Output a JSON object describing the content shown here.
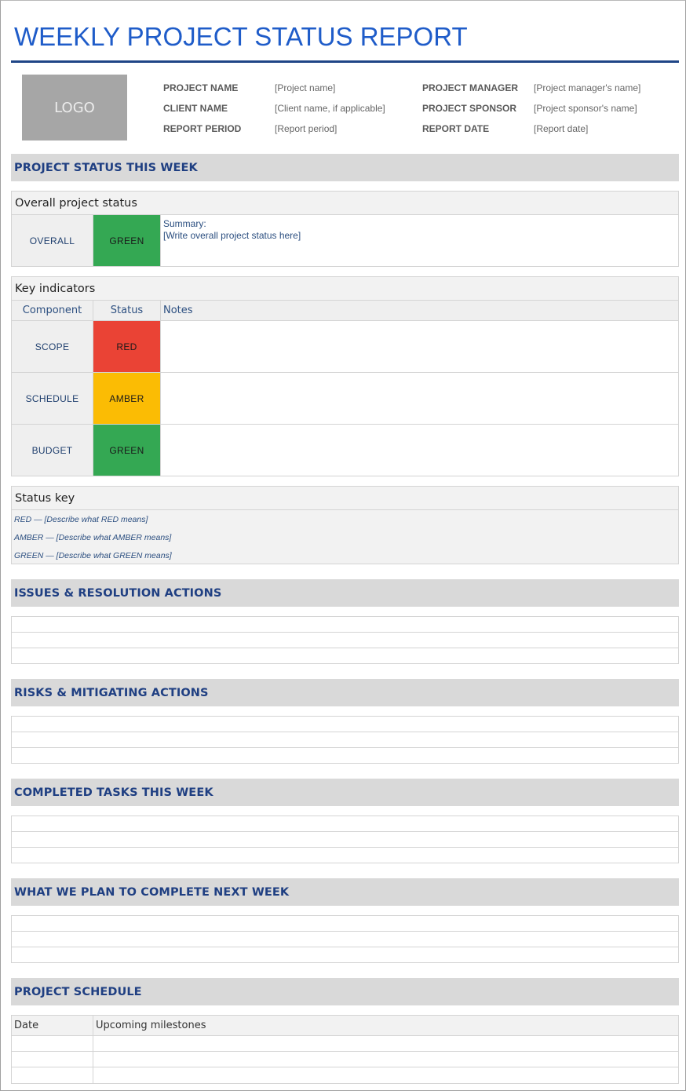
{
  "document": {
    "title": "WEEKLY PROJECT STATUS REPORT",
    "logo_label": "LOGO"
  },
  "meta": {
    "left": [
      {
        "label": "PROJECT NAME",
        "value": "[Project name]"
      },
      {
        "label": "CLIENT NAME",
        "value": "[Client name, if applicable]"
      },
      {
        "label": "REPORT PERIOD",
        "value": "[Report period]"
      }
    ],
    "right": [
      {
        "label": "PROJECT MANAGER",
        "value": "[Project manager's name]"
      },
      {
        "label": "PROJECT SPONSOR",
        "value": "[Project sponsor's name]"
      },
      {
        "label": "REPORT DATE",
        "value": "[Report date]"
      }
    ]
  },
  "status_section": {
    "header": "PROJECT STATUS THIS WEEK",
    "overall": {
      "title": "Overall project status",
      "component": "OVERALL",
      "status": "GREEN",
      "status_color": "#34a853",
      "summary_label": "Summary:",
      "summary_text": "[Write overall project status here]"
    },
    "key_indicators": {
      "title": "Key indicators",
      "columns": [
        "Component",
        "Status",
        "Notes"
      ],
      "rows": [
        {
          "component": "SCOPE",
          "status": "RED",
          "color": "#ea4335",
          "notes": ""
        },
        {
          "component": "SCHEDULE",
          "status": "AMBER",
          "color": "#fbbc04",
          "notes": ""
        },
        {
          "component": "BUDGET",
          "status": "GREEN",
          "color": "#34a853",
          "notes": ""
        }
      ]
    },
    "status_key": {
      "title": "Status key",
      "items": [
        "RED — [Describe what RED means]",
        "AMBER — [Describe what AMBER means]",
        "GREEN — [Describe what GREEN means]"
      ]
    }
  },
  "sections": {
    "issues": {
      "header": "ISSUES & RESOLUTION ACTIONS",
      "rows": [
        "",
        "",
        ""
      ]
    },
    "risks": {
      "header": "RISKS & MITIGATING ACTIONS",
      "rows": [
        "",
        "",
        ""
      ]
    },
    "completed": {
      "header": "COMPLETED TASKS THIS WEEK",
      "rows": [
        "",
        "",
        ""
      ]
    },
    "planned": {
      "header": "WHAT WE PLAN TO COMPLETE NEXT WEEK",
      "rows": [
        "",
        "",
        ""
      ]
    }
  },
  "schedule": {
    "header": "PROJECT SCHEDULE",
    "columns": [
      "Date",
      "Upcoming milestones"
    ],
    "rows": [
      {
        "date": "",
        "milestone": ""
      },
      {
        "date": "",
        "milestone": ""
      },
      {
        "date": "",
        "milestone": ""
      }
    ]
  },
  "colors": {
    "title_blue": "#1f5cc9",
    "rule_navy": "#1f4586",
    "section_header_text": "#1f3f82",
    "section_header_bg": "#d9d9d9"
  }
}
